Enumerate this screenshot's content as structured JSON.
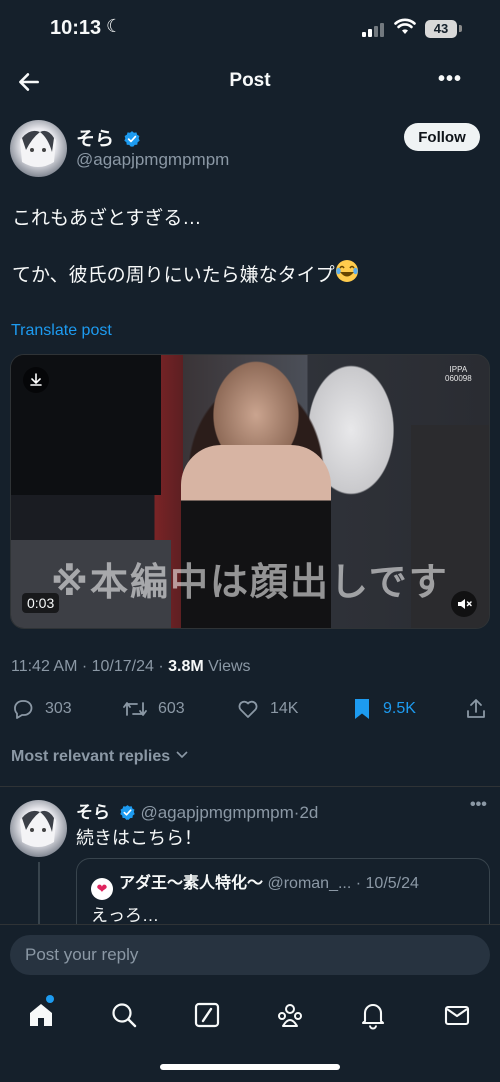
{
  "status_bar": {
    "time": "10:13",
    "battery": "43"
  },
  "header": {
    "title": "Post"
  },
  "author": {
    "display_name": "そら",
    "handle": "@agapjpmgmpmpm",
    "follow_label": "Follow"
  },
  "post": {
    "line1": "これもあざとすぎる…",
    "line2": "てか、彼氏の周りにいたら嫌なタイプ",
    "translate_label": "Translate post"
  },
  "media": {
    "subtitle_text": "※本編中は顔出しです",
    "duration": "0:03",
    "watermark_top": "IPPA",
    "watermark_bottom": "060098"
  },
  "meta": {
    "time": "11:42 AM · 10/17/24 · ",
    "views_count": "3.8M",
    "views_label": " Views"
  },
  "actions": {
    "replies": "303",
    "reposts": "603",
    "likes": "14K",
    "bookmarks": "9.5K"
  },
  "replies_filter": {
    "label": "Most relevant replies"
  },
  "reply": {
    "name": "そら",
    "handle": "@agapjpmgmpmpm",
    "age": "·2d",
    "text": "続きはこちら！",
    "quote": {
      "name": "アダ王〜素人特化〜",
      "handle": "@roman_...",
      "date": "· 10/5/24",
      "text": "えっろ…"
    }
  },
  "composer": {
    "placeholder": "Post your reply"
  },
  "colors": {
    "background": "#15202b",
    "accent": "#1d9bf0",
    "muted": "#8b98a5"
  },
  "tabbar": {
    "items": [
      "home-icon",
      "search-icon",
      "grok-icon",
      "communities-icon",
      "notifications-icon",
      "messages-icon"
    ]
  }
}
